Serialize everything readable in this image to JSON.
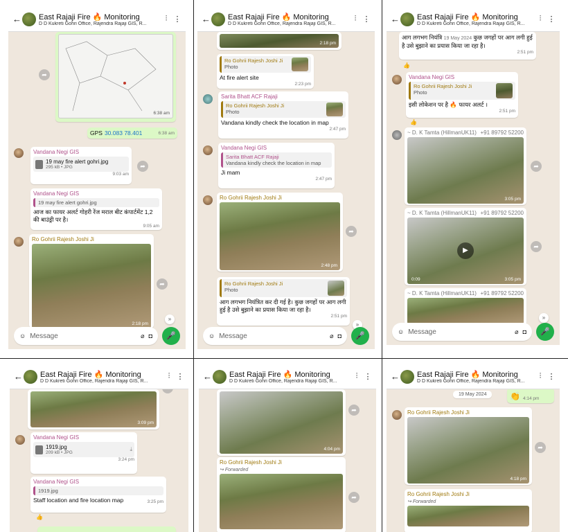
{
  "header": {
    "title": "East Rajaji Fire 🔥 Monitoring",
    "subtitle": "D D Kukreti Gohri Office, Rajendra Rajaji GIS, R..."
  },
  "composer": {
    "placeholder": "Message"
  },
  "p1": {
    "map_time": "6:38 am",
    "gps_text": "GPS",
    "gps_value": "30.083 78.401",
    "gps_time": "6:38 am",
    "m1_sender": "Vandana Negi GIS",
    "m1_doc": "19 may fire alert gohri.jpg",
    "m1_doc_sub": "295 kB • JPG",
    "m1_time": "9:03 am",
    "m2_sender": "Vandana Negi GIS",
    "m2_quote": "19 may fire alert gohri.jpg",
    "m2_text": "आज का फायर अलर्ट गोहरी रेंज मराल बीट कंपार्टमेंट 1,2 की बाउंड्री पर है।",
    "m2_time": "9:05 am",
    "m3_sender": "Ro Gohrii Rajesh Joshi Ji",
    "m3_time": "2:18 pm"
  },
  "p2": {
    "top_time": "2:18 pm",
    "m1_quote_name": "Ro Gohrii Rajesh Joshi Ji",
    "m1_quote_text": "Photo",
    "m1_text": "At fire alert site",
    "m1_time": "2:23 pm",
    "m2_sender": "Sarita Bhatt ACF Rajaji",
    "m2_quote_name": "Ro Gohrii Rajesh Joshi Ji",
    "m2_quote_text": "Photo",
    "m2_text": "Vandana kindly check the location in map",
    "m2_time": "2:47 pm",
    "m3_sender": "Vandana Negi GIS",
    "m3_quote_name": "Sarita Bhatt ACF Rajaji",
    "m3_quote_text": "Vandana kindly check the location in map",
    "m3_text": "Ji mam",
    "m3_time": "2:47 pm",
    "m4_sender": "Ro Gohrii Rajesh Joshi Ji",
    "m4_time": "2:48 pm",
    "m5_quote_name": "Ro Gohrii Rajesh Joshi Ji",
    "m5_quote_text": "Photo",
    "m5_text": "आग लगभग नियंत्रित कर दी गई है। कुछ जगहों पर आग लगी हुई है उसे बुझाने का प्रयास किया जा रहा है।",
    "m5_time": "2:51 pm"
  },
  "p3": {
    "top_text": "आग लगभग नियंत्रि",
    "top_date": "19 May 2024",
    "top_text2": "कुछ जगहों पर आग लगी हुई है उसे बुझाने का प्रयास किया जा रहा है।",
    "top_time": "2:51 pm",
    "m1_sender": "Vandana Negi GIS",
    "m1_quote_name": "Ro Gohrii Rajesh Joshi Ji",
    "m1_quote_text": "Photo",
    "m1_text": "इसी लोकेशन पर है 🔥 फायर अलर्ट ।",
    "m1_time": "2:51 pm",
    "m2_sender": "~ D. K Tamta (HillmanUK11)",
    "m2_phone": "+91 89792 52200",
    "m2_time": "3:05 pm",
    "m3_sender": "~ D. K Tamta (HillmanUK11)",
    "m3_phone": "+91 89792 52200",
    "m3_duration": "0:09",
    "m3_time": "3:05 pm",
    "m4_sender": "~ D. K Tamta (HillmanUK11)",
    "m4_phone": "+91 89792 52200"
  },
  "p4": {
    "top_time": "3:09 pm",
    "m1_sender": "Vandana Negi GIS",
    "m1_doc": "1919.jpg",
    "m1_doc_sub": "209 kB • JPG",
    "m1_time": "3:24 pm",
    "m2_sender": "Vandana Negi GIS",
    "m2_quote": "1919.jpg",
    "m2_text": "Staff location and fire location map",
    "m2_time": "3:25 pm"
  },
  "p5": {
    "m1_time": "4:04 pm",
    "m2_sender": "Ro Gohrii Rajesh Joshi Ji",
    "m2_fwd": "Forwarded"
  },
  "p6": {
    "date_chip": "19 May 2024",
    "wave_time": "4:14 pm",
    "m1_sender": "Ro Gohrii Rajesh Joshi Ji",
    "m1_time": "4:18 pm",
    "m2_sender": "Ro Gohrii Rajesh Joshi Ji",
    "m2_fwd": "Forwarded"
  }
}
